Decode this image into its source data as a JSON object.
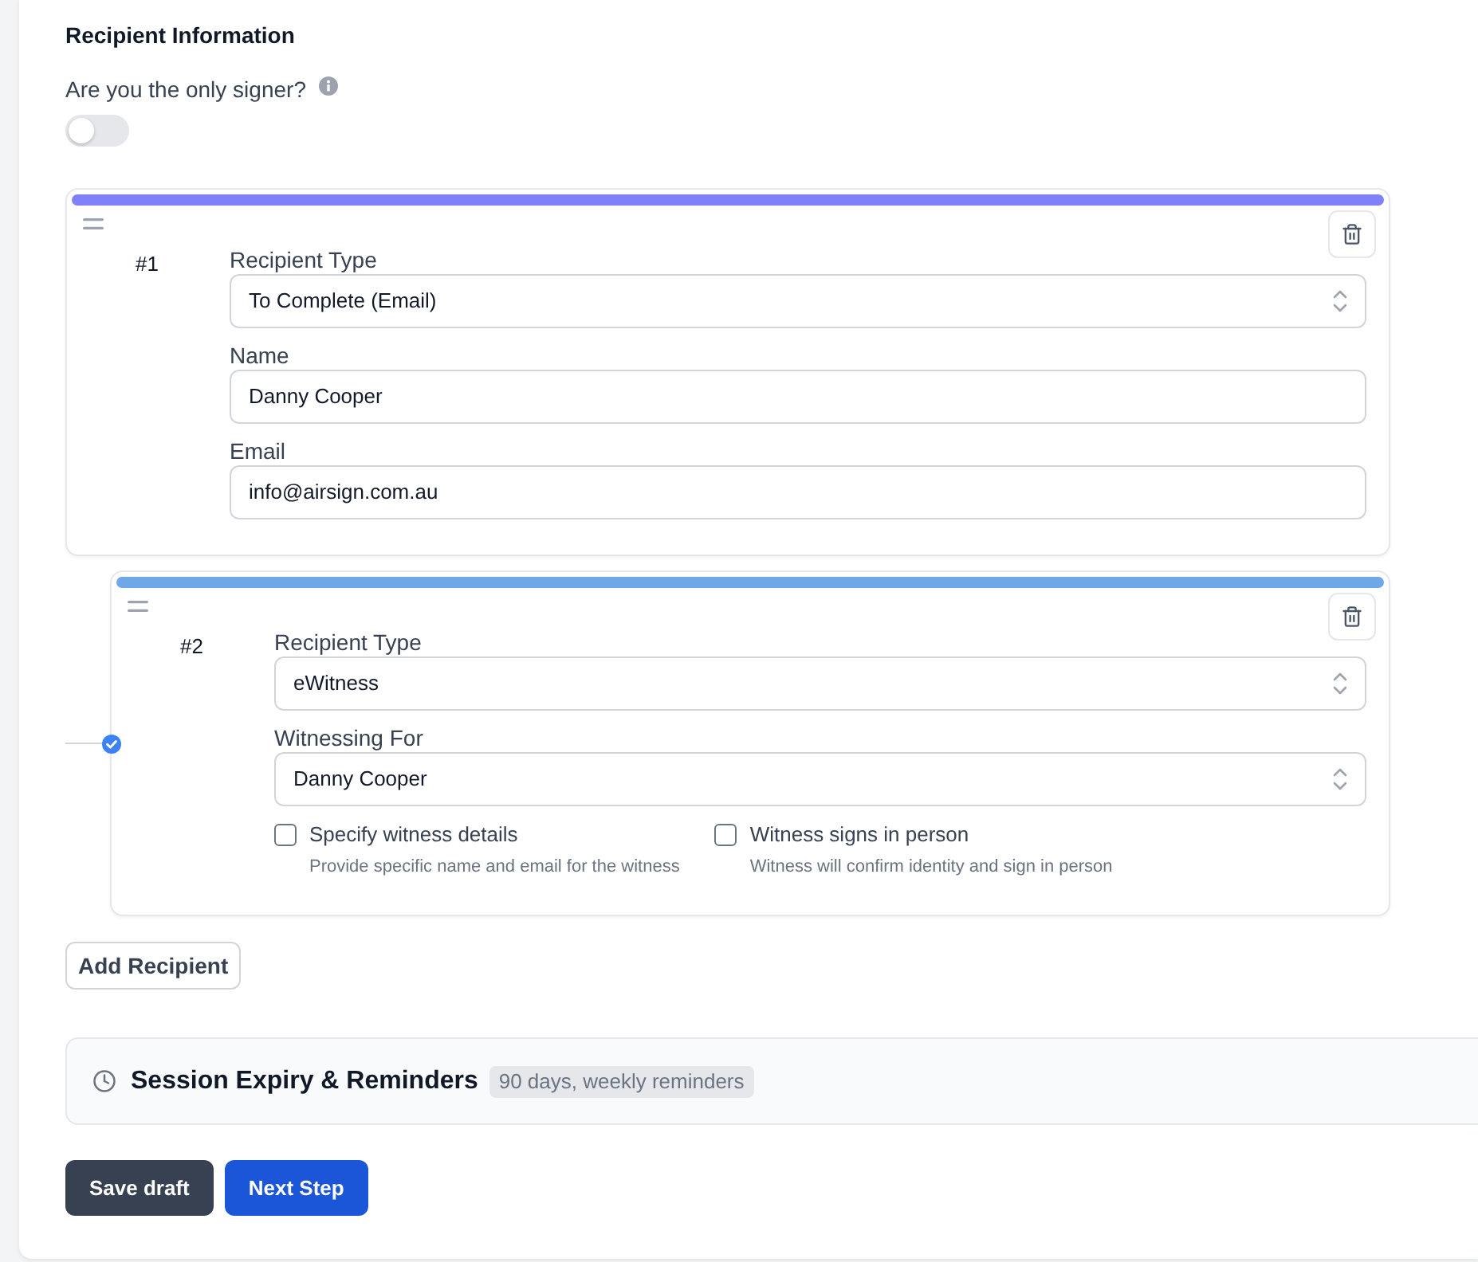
{
  "section": {
    "title": "Recipient Information"
  },
  "only_signer": {
    "label": "Are you the only signer?",
    "on": false
  },
  "recipients": [
    {
      "kind": "signer",
      "number": "#1",
      "color": "#8080f8",
      "fields": [
        {
          "kind": "select",
          "label": "Recipient Type",
          "value": "To Complete (Email)"
        },
        {
          "kind": "input",
          "label": "Name",
          "value": "Danny Cooper"
        },
        {
          "kind": "input",
          "label": "Email",
          "value": "info@airsign.com.au"
        }
      ]
    },
    {
      "kind": "witness",
      "number": "#2",
      "color": "#6fa8e8",
      "fields": [
        {
          "kind": "select",
          "label": "Recipient Type",
          "value": "eWitness"
        },
        {
          "kind": "select",
          "label": "Witnessing For",
          "value": "Danny Cooper"
        }
      ],
      "options": [
        {
          "label": "Specify witness details",
          "description": "Provide specific name and email for the witness",
          "checked": false
        },
        {
          "label": "Witness signs in person",
          "description": "Witness will confirm identity and sign in person",
          "checked": false
        }
      ]
    }
  ],
  "add_button": {
    "label": "Add Recipient"
  },
  "session": {
    "title": "Session Expiry & Reminders",
    "summary": "90 days, weekly reminders"
  },
  "actions": [
    {
      "kind": "secondary",
      "label": "Save draft"
    },
    {
      "kind": "primary",
      "label": "Next Step"
    }
  ]
}
